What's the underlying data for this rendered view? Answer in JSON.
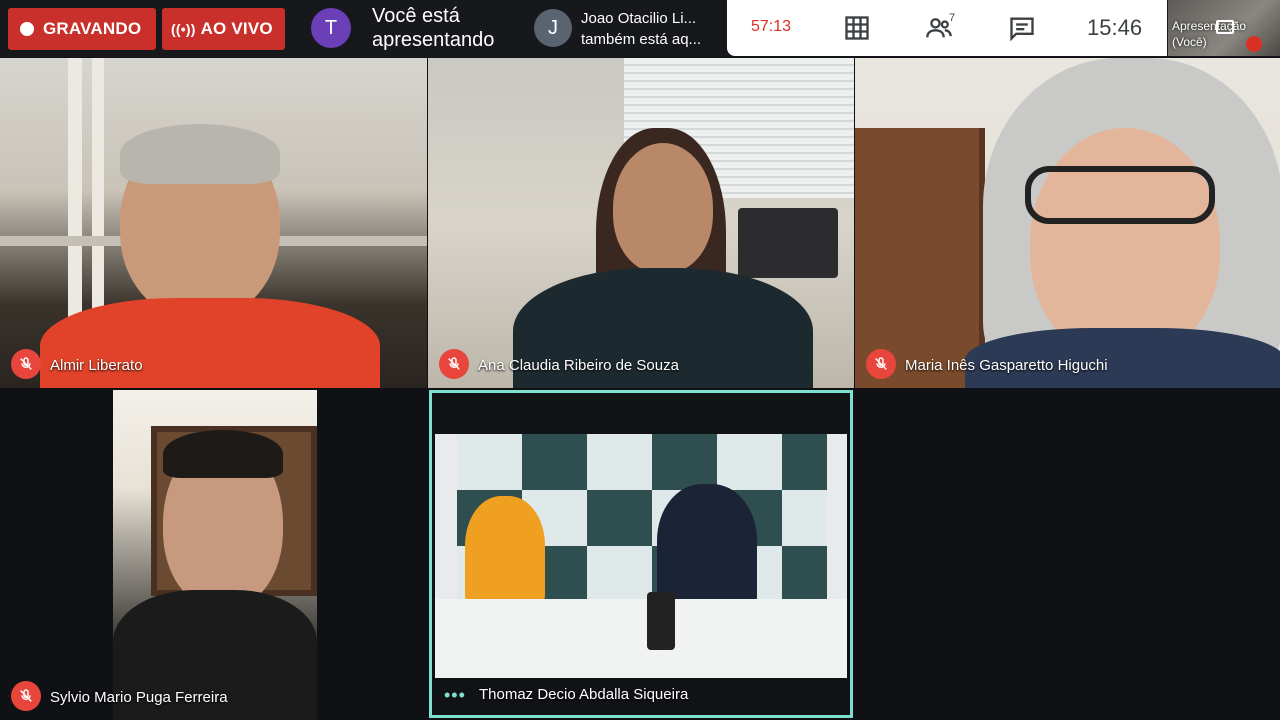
{
  "topbar": {
    "recording_label": "GRAVANDO",
    "live_label": "AO VIVO",
    "presenter_avatar": "T",
    "presenting_text_line1": "Você está",
    "presenting_text_line2": "apresentando",
    "other_presenter_avatar": "J",
    "other_presenter_line1": "Joao Otacilio Li...",
    "other_presenter_line2": "também está aq...",
    "timer": "57:13",
    "participants_badge": "7",
    "clock": "15:46",
    "self_view_line1": "Apresentação",
    "self_view_line2": "(Você)"
  },
  "tiles": [
    {
      "name": "Almir Liberato",
      "muted": true
    },
    {
      "name": "Ana Claudia Ribeiro de Souza",
      "muted": true
    },
    {
      "name": "Maria Inês Gasparetto Higuchi",
      "muted": true
    },
    {
      "name": "Sylvio Mario Puga Ferreira",
      "muted": true
    },
    {
      "name": "Thomaz Decio Abdalla Siqueira",
      "muted": false,
      "speaking": true
    }
  ],
  "colors": {
    "record_red": "#c9302c",
    "mic_off_red": "#e8453c",
    "active_speaker_border": "#7ee0cf",
    "timer_red": "#d93025"
  },
  "icons": {
    "grid": "grid-layout-icon",
    "people": "people-icon",
    "chat": "chat-icon",
    "mic_off": "mic-off-icon",
    "record": "record-dot-icon",
    "live": "live-broadcast-icon"
  }
}
